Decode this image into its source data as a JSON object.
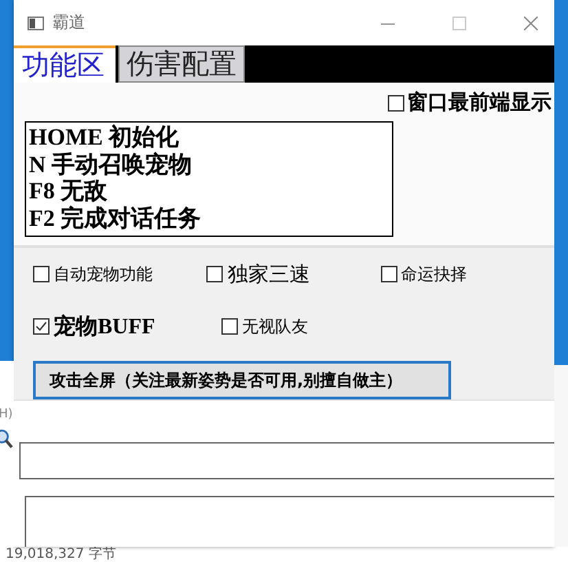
{
  "window": {
    "title": "霸道"
  },
  "tabs": [
    {
      "label": "功能区",
      "selected": true
    },
    {
      "label": "伤害配置",
      "selected": false
    }
  ],
  "topmost": {
    "label": "窗口最前端显示",
    "checked": false
  },
  "hotkeys": [
    "HOME 初始化",
    "N 手动召唤宠物",
    "F8 无敌",
    "F2 完成对话任务"
  ],
  "option_rows": [
    [
      {
        "label": "自动宠物功能",
        "checked": false,
        "kind": "plain"
      },
      {
        "label": "独家三速",
        "checked": false,
        "kind": "large"
      },
      {
        "label": "命运抉择",
        "checked": false,
        "kind": "plain"
      }
    ],
    [
      {
        "label": "宠物BUFF",
        "checked": true,
        "kind": "bold"
      },
      {
        "label": "无视队友",
        "checked": false,
        "kind": "plain"
      }
    ]
  ],
  "action_button": "攻击全屏（关注最新姿势是否可用,别擅自做主）",
  "background": {
    "menu_fragment": "H)",
    "status": "19,018,327 字节"
  }
}
